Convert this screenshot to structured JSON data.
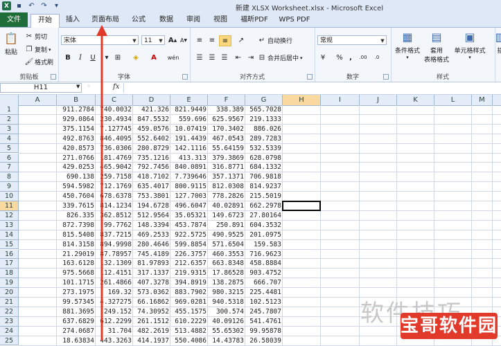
{
  "window": {
    "title": "新建 XLSX Worksheet.xlsx - Microsoft Excel"
  },
  "qat": {
    "app_icon": "excel-icon",
    "save_icon": "save-icon",
    "undo_icon": "undo-icon",
    "redo_icon": "redo-icon",
    "customize_icon": "customize-qat-icon"
  },
  "tabs": [
    {
      "label": "文件"
    },
    {
      "label": "开始"
    },
    {
      "label": "插入"
    },
    {
      "label": "页面布局"
    },
    {
      "label": "公式"
    },
    {
      "label": "数据"
    },
    {
      "label": "审阅"
    },
    {
      "label": "视图"
    },
    {
      "label": "福昕PDF"
    },
    {
      "label": "WPS PDF"
    }
  ],
  "ribbon": {
    "clipboard": {
      "paste": "粘贴",
      "cut": "剪切",
      "copy": "复制",
      "format_painter": "格式刷",
      "label": "剪贴板"
    },
    "font": {
      "name": "宋体",
      "size": "11",
      "label": "字体",
      "bold": "B",
      "italic": "I",
      "underline": "U",
      "font_color_letter": "A",
      "grow": "A",
      "shrink": "A",
      "wen": "wén"
    },
    "alignment": {
      "wrap": "自动换行",
      "merge": "合并后居中",
      "label": "对齐方式"
    },
    "number": {
      "format": "常规",
      "percent": "%",
      "comma": ",",
      "dec_inc": ".00",
      "dec_dec": ".0",
      "label": "数字"
    },
    "styles": {
      "conditional": "条件格式",
      "table1": "套用",
      "table2": "表格格式",
      "cell_styles": "单元格样式",
      "label": "样式",
      "insert": "插"
    }
  },
  "formula_bar": {
    "name_box": "H11",
    "fx": "fx",
    "value": ""
  },
  "columns": [
    "A",
    "B",
    "C",
    "D",
    "E",
    "F",
    "G",
    "H",
    "I",
    "J",
    "K",
    "L",
    "M"
  ],
  "selected_column": "H",
  "selected_row": "11",
  "rows": [
    {
      "num": "1",
      "B": "911.2784",
      "C": "740.0032",
      "D": "421.326",
      "E": "821.9449",
      "F": "338.389",
      "G": "565.7028"
    },
    {
      "num": "2",
      "B": "929.0864",
      "C": "230.4934",
      "D": "847.5532",
      "E": "559.696",
      "F": "625.9567",
      "G": "219.1333"
    },
    {
      "num": "3",
      "B": "375.1154",
      "C": "7.127745",
      "D": "459.0576",
      "E": "10.07419",
      "F": "170.3402",
      "G": "886.026"
    },
    {
      "num": "4",
      "B": "492.8763",
      "C": "846.4095",
      "D": "552.6402",
      "E": "191.4439",
      "F": "467.0543",
      "G": "289.7283"
    },
    {
      "num": "5",
      "B": "420.8573",
      "C": "736.0306",
      "D": "280.8729",
      "E": "142.1116",
      "F": "55.64159",
      "G": "532.5339"
    },
    {
      "num": "6",
      "B": "271.0766",
      "C": "181.4769",
      "D": "735.1216",
      "E": "413.313",
      "F": "379.3869",
      "G": "628.0798"
    },
    {
      "num": "7",
      "B": "429.0253",
      "C": "465.9042",
      "D": "792.7456",
      "E": "840.0891",
      "F": "316.8771",
      "G": "684.1332"
    },
    {
      "num": "8",
      "B": "690.138",
      "C": "259.7158",
      "D": "418.7102",
      "E": "7.739646",
      "F": "357.1371",
      "G": "706.9818"
    },
    {
      "num": "9",
      "B": "594.5982",
      "C": "712.1769",
      "D": "635.4017",
      "E": "800.9115",
      "F": "812.0308",
      "G": "814.9237"
    },
    {
      "num": "10",
      "B": "450.7604",
      "C": "678.6378",
      "D": "753.3801",
      "E": "127.7003",
      "F": "778.2826",
      "G": "215.5019"
    },
    {
      "num": "11",
      "B": "339.7615",
      "C": "814.1234",
      "D": "194.6728",
      "E": "496.6047",
      "F": "40.02891",
      "G": "662.2978"
    },
    {
      "num": "12",
      "B": "826.335",
      "C": "362.8512",
      "D": "512.9564",
      "E": "35.05321",
      "F": "149.6723",
      "G": "27.80164"
    },
    {
      "num": "13",
      "B": "872.7398",
      "C": "99.7762",
      "D": "148.3394",
      "E": "453.7874",
      "F": "250.891",
      "G": "604.3532"
    },
    {
      "num": "14",
      "B": "815.5408",
      "C": "837.7215",
      "D": "469.2533",
      "E": "922.5725",
      "F": "490.9525",
      "G": "201.0975"
    },
    {
      "num": "15",
      "B": "814.3158",
      "C": "894.9998",
      "D": "280.4646",
      "E": "599.8854",
      "F": "571.6504",
      "G": "159.583"
    },
    {
      "num": "16",
      "B": "21.29019",
      "C": "87.78957",
      "D": "745.4189",
      "E": "226.3757",
      "F": "460.3553",
      "G": "716.9623"
    },
    {
      "num": "17",
      "B": "163.6128",
      "C": "132.1309",
      "D": "81.97893",
      "E": "212.6357",
      "F": "663.8348",
      "G": "458.8884"
    },
    {
      "num": "18",
      "B": "975.5668",
      "C": "112.4151",
      "D": "317.1337",
      "E": "219.9315",
      "F": "17.86528",
      "G": "903.4752"
    },
    {
      "num": "19",
      "B": "101.1715",
      "C": "261.4866",
      "D": "407.3278",
      "E": "394.8919",
      "F": "138.2875",
      "G": "666.707"
    },
    {
      "num": "20",
      "B": "273.1975",
      "C": "169.32",
      "D": "573.0362",
      "E": "883.7902",
      "F": "980.3215",
      "G": "225.4481"
    },
    {
      "num": "21",
      "B": "99.57345",
      "C": "4.327275",
      "D": "66.16862",
      "E": "969.0281",
      "F": "940.5318",
      "G": "102.5123"
    },
    {
      "num": "22",
      "B": "881.3695",
      "C": "249.152",
      "D": "74.30952",
      "E": "455.1575",
      "F": "300.574",
      "G": "245.7807"
    },
    {
      "num": "23",
      "B": "637.6829",
      "C": "612.2299",
      "D": "261.1512",
      "E": "610.2229",
      "F": "40.09126",
      "G": "541.4761"
    },
    {
      "num": "24",
      "B": "274.0687",
      "C": "31.704",
      "D": "482.2619",
      "E": "513.4882",
      "F": "55.65302",
      "G": "99.95878"
    },
    {
      "num": "25",
      "B": "18.63834",
      "C": "443.3263",
      "D": "414.1937",
      "E": "550.4086",
      "F": "14.43783",
      "G": "26.58039"
    }
  ],
  "watermark": {
    "text": "软件技巧",
    "logo_text": "宝哥软件园"
  }
}
